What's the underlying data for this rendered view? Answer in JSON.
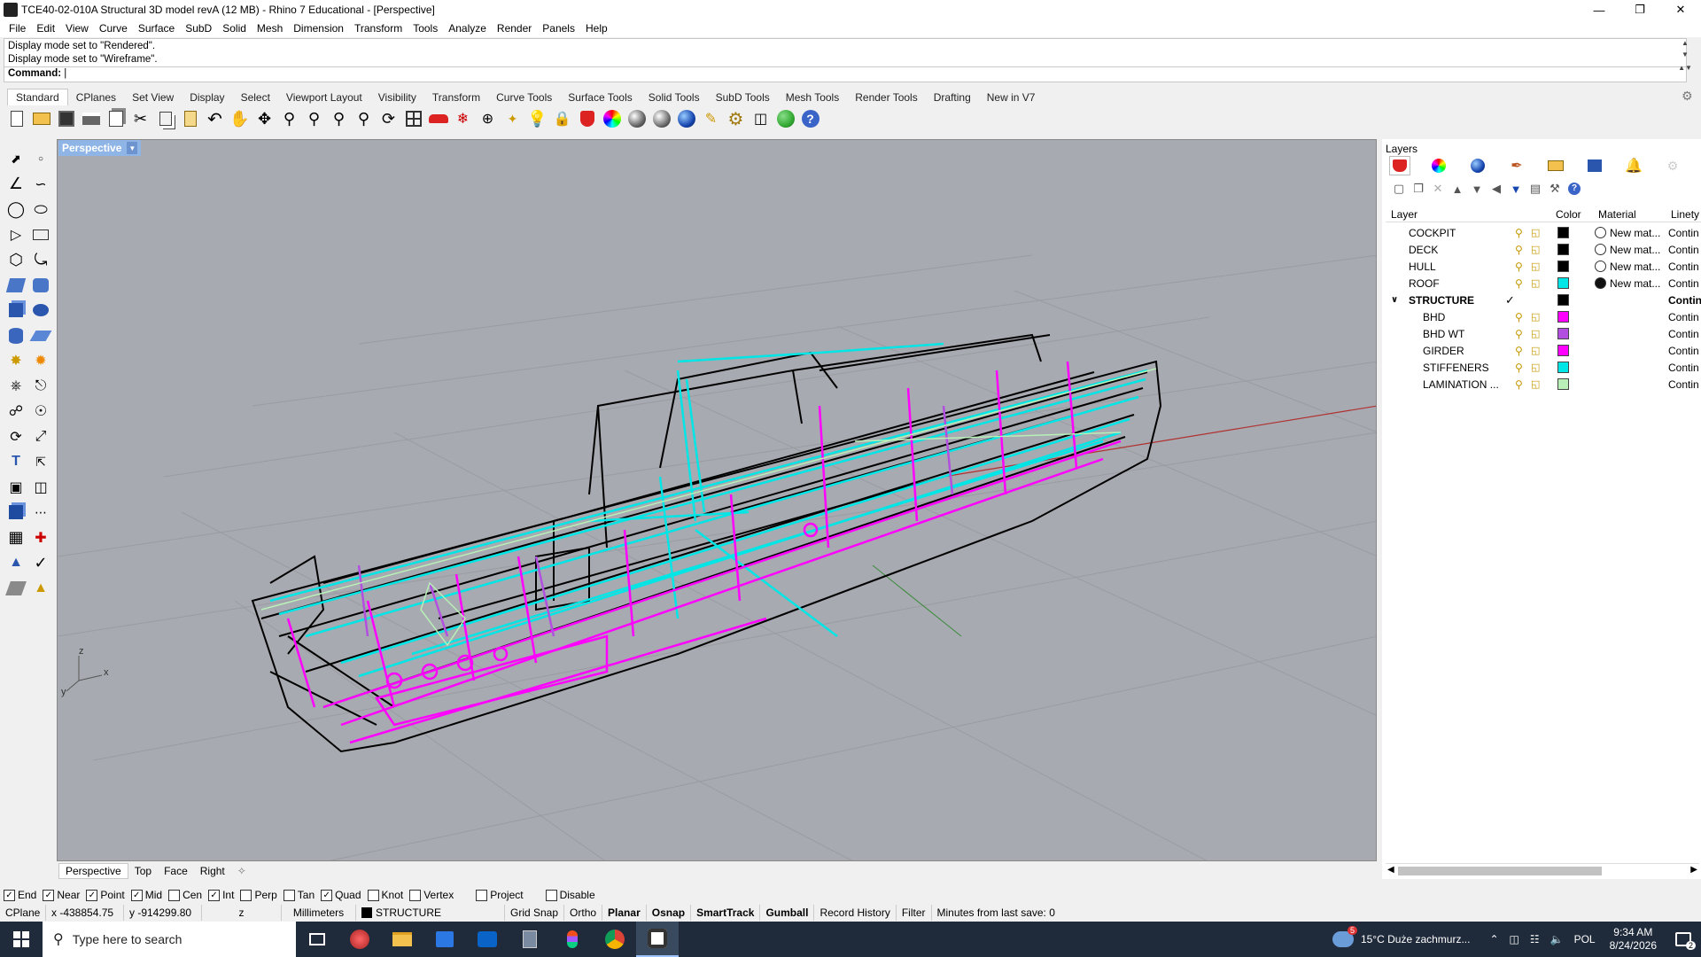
{
  "window": {
    "title": "TCE40-02-010A Structural 3D model revA (12 MB) - Rhino 7 Educational - [Perspective]"
  },
  "menu": [
    "File",
    "Edit",
    "View",
    "Curve",
    "Surface",
    "SubD",
    "Solid",
    "Mesh",
    "Dimension",
    "Transform",
    "Tools",
    "Analyze",
    "Render",
    "Panels",
    "Help"
  ],
  "command": {
    "history": [
      "Display mode set to \"Rendered\".",
      "Display mode set to \"Wireframe\"."
    ],
    "prompt": "Command:"
  },
  "toolbar_tabs": [
    "Standard",
    "CPlanes",
    "Set View",
    "Display",
    "Select",
    "Viewport Layout",
    "Visibility",
    "Transform",
    "Curve Tools",
    "Surface Tools",
    "Solid Tools",
    "SubD Tools",
    "Mesh Tools",
    "Render Tools",
    "Drafting",
    "New in V7"
  ],
  "toolbar_icons": [
    "new-file",
    "open-file",
    "save-file",
    "print",
    "import",
    "cut",
    "copy",
    "paste",
    "undo",
    "pan",
    "rotate-view",
    "zoom",
    "zoom-window",
    "zoom-extents",
    "zoom-selected",
    "undo-view",
    "four-viewports",
    "car-render",
    "rotate-light",
    "plane-tool",
    "point-tool",
    "light-bulb",
    "lock",
    "material-shield",
    "color-wheel",
    "shaded-sphere",
    "rendered-sphere",
    "blue-sphere",
    "pencil-tool",
    "gear-options",
    "grid-snap",
    "world-globe",
    "help"
  ],
  "viewport": {
    "name": "Perspective",
    "tabs": [
      "Perspective",
      "Top",
      "Face",
      "Right"
    ],
    "axes": {
      "x": "x",
      "y": "y",
      "z": "z"
    }
  },
  "layers_panel": {
    "title": "Layers",
    "columns": {
      "layer": "Layer",
      "color": "Color",
      "material": "Material",
      "linetype": "Linety"
    },
    "rows": [
      {
        "name": "COCKPIT",
        "color": "#000000",
        "material": "New mat...",
        "material_fill": "#ffffff",
        "linetype": "Contin",
        "child": false
      },
      {
        "name": "DECK",
        "color": "#000000",
        "material": "New mat...",
        "material_fill": "#ffffff",
        "linetype": "Contin",
        "child": false
      },
      {
        "name": "HULL",
        "color": "#000000",
        "material": "New mat...",
        "material_fill": "#ffffff",
        "linetype": "Contin",
        "child": false
      },
      {
        "name": "ROOF",
        "color": "#00e5e5",
        "material": "New mat...",
        "material_fill": "#111111",
        "linetype": "Contin",
        "child": false
      },
      {
        "name": "STRUCTURE",
        "color": "#000000",
        "material": "",
        "material_fill": "",
        "linetype": "Contin",
        "child": false,
        "current": true
      },
      {
        "name": "BHD",
        "color": "#ff00ff",
        "material": "",
        "material_fill": "",
        "linetype": "Contin",
        "child": true
      },
      {
        "name": "BHD WT",
        "color": "#b24fe0",
        "material": "",
        "material_fill": "",
        "linetype": "Contin",
        "child": true
      },
      {
        "name": "GIRDER",
        "color": "#ff00ff",
        "material": "",
        "material_fill": "",
        "linetype": "Contin",
        "child": true
      },
      {
        "name": "STIFFENERS",
        "color": "#00e5e5",
        "material": "",
        "material_fill": "",
        "linetype": "Contin",
        "child": true
      },
      {
        "name": "LAMINATION ...",
        "color": "#b8f0b8",
        "material": "",
        "material_fill": "",
        "linetype": "Contin",
        "child": true
      }
    ]
  },
  "osnaps": [
    {
      "label": "End",
      "checked": true
    },
    {
      "label": "Near",
      "checked": true
    },
    {
      "label": "Point",
      "checked": true
    },
    {
      "label": "Mid",
      "checked": true
    },
    {
      "label": "Cen",
      "checked": false
    },
    {
      "label": "Int",
      "checked": true
    },
    {
      "label": "Perp",
      "checked": false
    },
    {
      "label": "Tan",
      "checked": false
    },
    {
      "label": "Quad",
      "checked": true
    },
    {
      "label": "Knot",
      "checked": false
    },
    {
      "label": "Vertex",
      "checked": false
    },
    {
      "label": "Project",
      "checked": false
    },
    {
      "label": "Disable",
      "checked": false
    }
  ],
  "status": {
    "cplane": "CPlane",
    "x": "x -438854.75",
    "y": "y -914299.80",
    "z": "z",
    "units": "Millimeters",
    "layer": "STRUCTURE",
    "grid_snap": "Grid Snap",
    "ortho": "Ortho",
    "planar": "Planar",
    "osnap": "Osnap",
    "smarttrack": "SmartTrack",
    "gumball": "Gumball",
    "record_history": "Record History",
    "filter": "Filter",
    "save_info": "Minutes from last save: 0"
  },
  "taskbar": {
    "search_placeholder": "Type here to search",
    "weather": "15°C  Duże zachmurz...",
    "weather_badge": "5",
    "language": "POL",
    "time": "9:34 AM",
    "date": "8/24/2026",
    "notifications": "2"
  },
  "colors": {
    "accent_tab": "#8fb4e6",
    "viewport_bg": "#a7aab0",
    "taskbar": "#1f2a3a",
    "magenta": "#ff00ff",
    "cyan": "#00e5e5"
  }
}
